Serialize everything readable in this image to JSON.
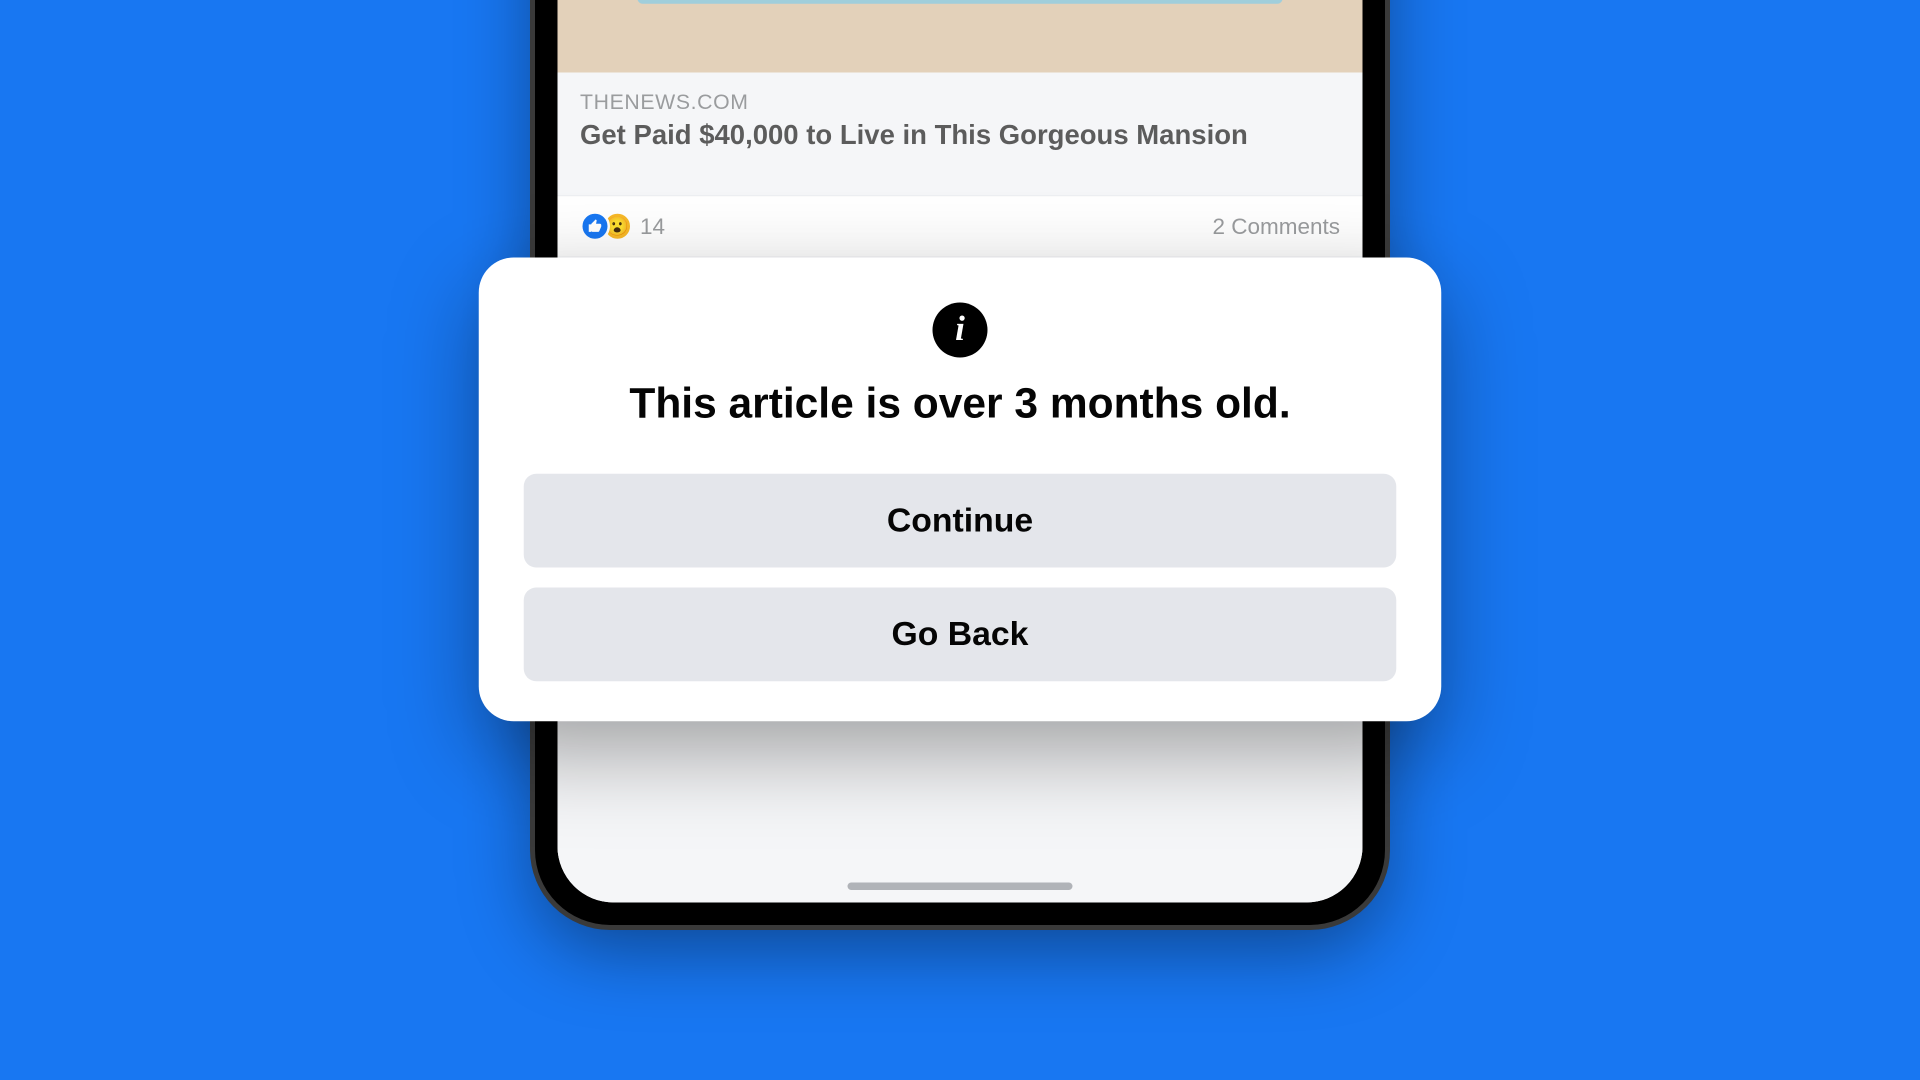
{
  "background_color": "#1877f2",
  "article": {
    "source": "THENEWS.COM",
    "headline": "Get Paid $40,000 to Live in This Gorgeous Mansion"
  },
  "stats": {
    "reaction_count": "14",
    "comments_text": "2 Comments"
  },
  "modal": {
    "title": "This article is over 3 months old.",
    "continue_label": "Continue",
    "goback_label": "Go Back"
  }
}
